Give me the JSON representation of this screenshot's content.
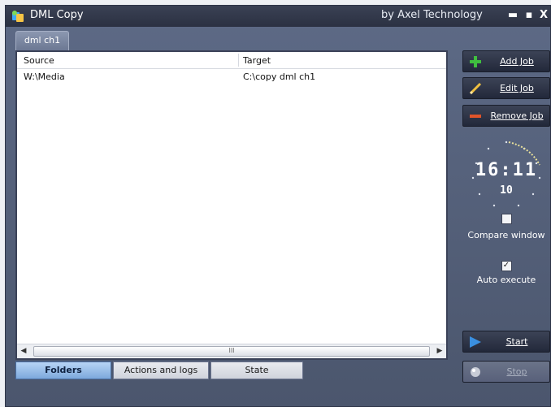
{
  "window": {
    "title": "DML Copy",
    "vendor": "by Axel Technology",
    "controls": [
      "minimize-icon",
      "maximize-icon",
      "close-icon"
    ]
  },
  "channel_tab": {
    "label": "dml ch1"
  },
  "table": {
    "columns": [
      "Source",
      "Target"
    ],
    "rows": [
      {
        "source": "W:\\Media",
        "target": "C:\\copy dml ch1"
      }
    ],
    "scroll_grip": "III"
  },
  "bottom_tabs": [
    {
      "label": "Folders",
      "active": true
    },
    {
      "label": "Actions and logs",
      "active": false
    },
    {
      "label": "State",
      "active": false
    }
  ],
  "buttons": {
    "add_job": "Add Job",
    "edit_job": "Edit Job",
    "remove_job": "Remove Job",
    "start": "Start",
    "stop": "Stop"
  },
  "clock": {
    "time": "16:11",
    "seconds": "10"
  },
  "options": {
    "compare_window": {
      "label": "Compare window",
      "checked": false
    },
    "auto_execute": {
      "label": "Auto execute",
      "checked": true
    }
  },
  "colors": {
    "window_bg": "#56627c",
    "titlebar": "#2b3142",
    "active_tab": "#7da9dc",
    "add_icon": "#3fbf3f",
    "remove_icon": "#e0542a",
    "edit_icon": "#f0c040",
    "start_icon": "#3a8fe0"
  }
}
